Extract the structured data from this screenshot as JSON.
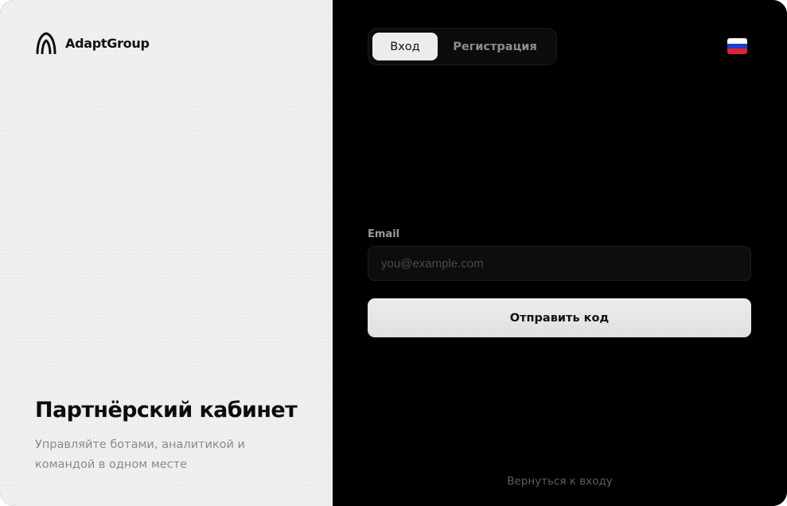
{
  "brand": {
    "name": "AdaptGroup",
    "logo_icon": "adaptgroup-logo-icon"
  },
  "hero": {
    "title": "Партнёрский кабинет",
    "subtitle": "Управляйте ботами, аналитикой и командой в одном месте"
  },
  "auth": {
    "tabs": [
      {
        "label": "Вход",
        "active": true
      },
      {
        "label": "Регистрация",
        "active": false
      }
    ],
    "email_label": "Email",
    "email_placeholder": "you@example.com",
    "email_value": "",
    "submit_label": "Отправить код",
    "back_link": "Вернуться к входу"
  },
  "language": {
    "icon": "russian-flag-icon",
    "flag_colors": [
      "#ffffff",
      "#1c3fcf",
      "#e0232e"
    ]
  },
  "colors": {
    "left_background": "#f2f2f2",
    "right_background": "#000000",
    "button_background": "#e6e6e6",
    "muted_text": "#8a8a8a"
  }
}
